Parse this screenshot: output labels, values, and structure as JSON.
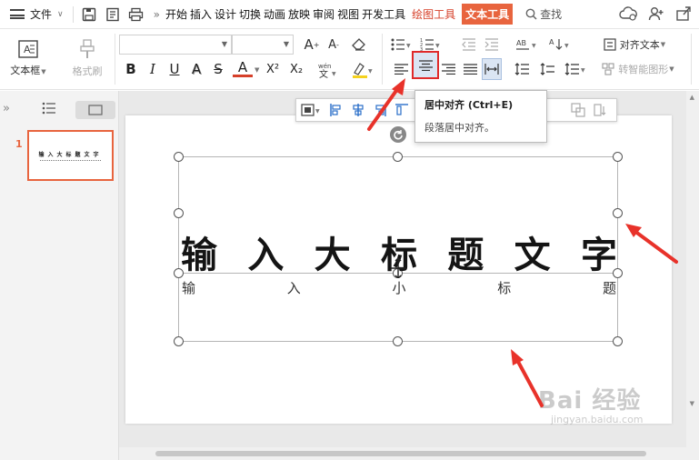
{
  "menubar": {
    "file_label": "文件",
    "tabs": [
      "开始",
      "插入",
      "设计",
      "切换",
      "动画",
      "放映",
      "审阅",
      "视图",
      "开发工具"
    ],
    "draw_tools": "绘图工具",
    "text_tools": "文本工具",
    "search": "查找"
  },
  "ribbon": {
    "textbox_label": "文本框",
    "format_painter_label": "格式刷",
    "format_buttons": [
      "B",
      "I",
      "U",
      "A",
      "S",
      "A",
      "X²",
      "X₂"
    ],
    "align_text_label": "对齐文本",
    "smartart_label": "转智能图形",
    "accent_color": "#d6402a",
    "highlight_color": "#f5d21f"
  },
  "tooltip": {
    "title": "居中对齐 (Ctrl+E)",
    "desc": "段落居中对齐。"
  },
  "slide_panel": {
    "slide_number": "1",
    "thumb_title": "输入大标题文字"
  },
  "slide": {
    "title_chars": [
      "输",
      "入",
      "大",
      "标",
      "题",
      "文",
      "字"
    ],
    "subtitle_chars": [
      "输",
      "入",
      "小",
      "标",
      "题"
    ]
  },
  "watermark": {
    "main": "Bai 经验",
    "sub": "jingyan.baidu.com"
  }
}
